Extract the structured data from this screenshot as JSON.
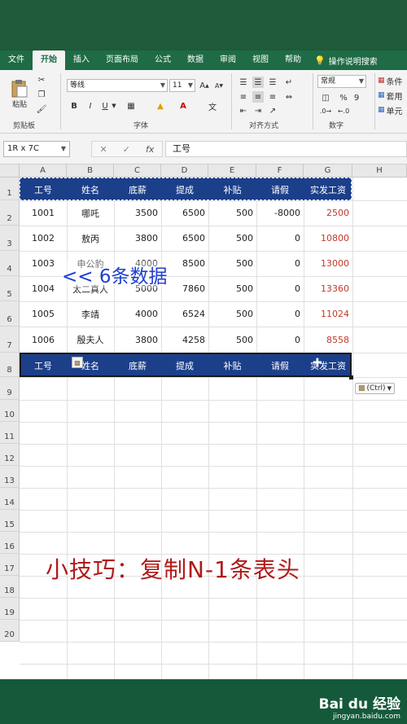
{
  "ribbon_tabs": [
    "文件",
    "开始",
    "插入",
    "页面布局",
    "公式",
    "数据",
    "审阅",
    "视图",
    "帮助"
  ],
  "help_search": "操作说明搜索",
  "clipboard": {
    "paste": "粘贴",
    "group": "剪贴板"
  },
  "font": {
    "name": "等线",
    "size": "11",
    "group": "字体",
    "grow": "A",
    "shrink": "A",
    "bold": "B",
    "italic": "I",
    "underline": "U",
    "color_letter": "A",
    "phonetic": "文"
  },
  "alignment": {
    "group": "对齐方式"
  },
  "number": {
    "format": "常规",
    "group": "数字",
    "percent": "%",
    "comma": "9"
  },
  "styles": {
    "items": [
      "条件",
      "套用",
      "单元"
    ]
  },
  "formula_bar": {
    "name_box": "1R x 7C",
    "fx": "fx",
    "content": "工号"
  },
  "columns": [
    "A",
    "B",
    "C",
    "D",
    "E",
    "F",
    "G",
    "H"
  ],
  "rows": [
    "1",
    "2",
    "3",
    "4",
    "5",
    "6",
    "7",
    "8",
    "9",
    "10",
    "11",
    "12",
    "13",
    "14",
    "15",
    "16",
    "17",
    "18",
    "19",
    "20"
  ],
  "header": [
    "工号",
    "姓名",
    "底薪",
    "提成",
    "补贴",
    "请假",
    "实发工资"
  ],
  "data_rows": [
    [
      "1001",
      "哪吒",
      "3500",
      "6500",
      "500",
      "-8000",
      "2500"
    ],
    [
      "1002",
      "敖丙",
      "3800",
      "6500",
      "500",
      "0",
      "10800"
    ],
    [
      "1003",
      "申公豹",
      "4000",
      "8500",
      "500",
      "0",
      "13000"
    ],
    [
      "1004",
      "太二真人",
      "5000",
      "7860",
      "500",
      "0",
      "13360"
    ],
    [
      "1005",
      "李靖",
      "4000",
      "6524",
      "500",
      "0",
      "11024"
    ],
    [
      "1006",
      "殷夫人",
      "3800",
      "4258",
      "500",
      "0",
      "8558"
    ]
  ],
  "paste_options": "(Ctrl)",
  "annotations": {
    "six_rows": "<< 6条数据",
    "tip": "小技巧：复制N-1条表头"
  },
  "watermark": {
    "brand": "Bai du 经验",
    "url": "jingyan.baidu.com"
  },
  "colors": {
    "header_fill": "#1c3f8a",
    "salary_text": "#c0392b",
    "tip_text": "#b01919",
    "annotation_text": "#1f3fd0",
    "ribbon_green": "#1e6b45"
  }
}
